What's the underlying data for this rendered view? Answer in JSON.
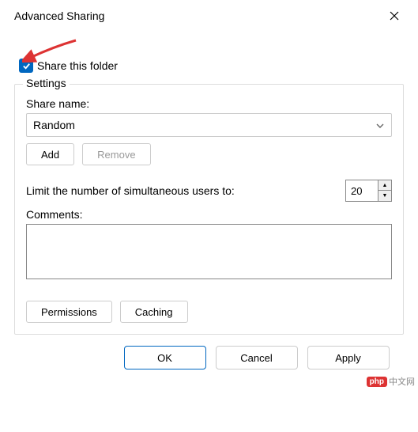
{
  "titlebar": {
    "title": "Advanced Sharing"
  },
  "share_checkbox": {
    "checked": true,
    "label": "Share this folder"
  },
  "settings": {
    "legend": "Settings",
    "share_name_label": "Share name:",
    "share_name_value": "Random",
    "add_label": "Add",
    "remove_label": "Remove",
    "limit_label": "Limit the number of simultaneous users to:",
    "limit_value": "20",
    "comments_label": "Comments:",
    "comments_value": "",
    "permissions_label": "Permissions",
    "caching_label": "Caching"
  },
  "dialog": {
    "ok": "OK",
    "cancel": "Cancel",
    "apply": "Apply"
  },
  "watermark": {
    "badge": "php",
    "text": "中文网"
  }
}
